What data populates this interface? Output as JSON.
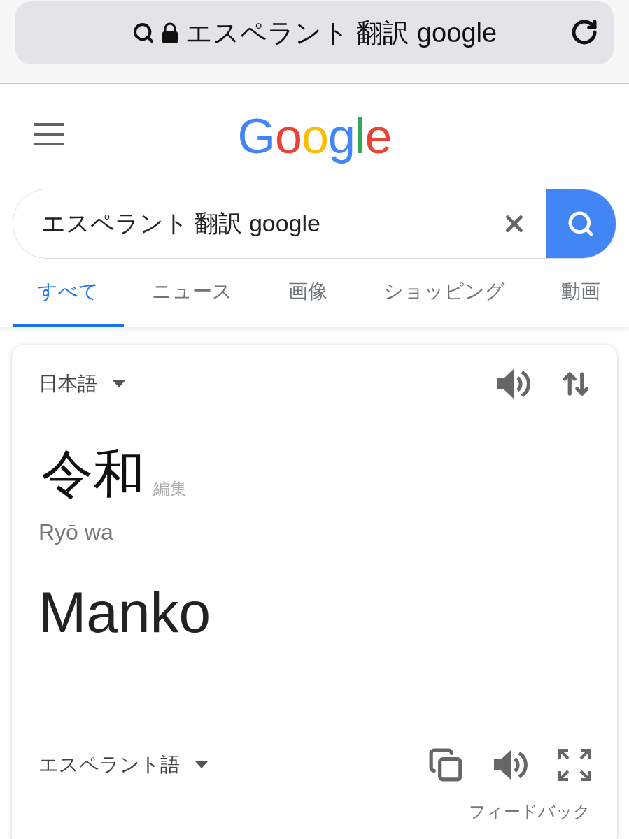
{
  "address_bar": {
    "text": "エスペラント 翻訳 google"
  },
  "logo": {
    "text": "Google"
  },
  "search": {
    "value": "エスペラント 翻訳 google"
  },
  "tabs": [
    {
      "label": "すべて",
      "selected": true
    },
    {
      "label": "ニュース",
      "selected": false
    },
    {
      "label": "画像",
      "selected": false
    },
    {
      "label": "ショッピング",
      "selected": false
    },
    {
      "label": "動画",
      "selected": false
    }
  ],
  "translation": {
    "source_language": "日本語",
    "source_text": "令和",
    "edit_label": "編集",
    "romanization": "Ryō wa",
    "result_text": "Manko",
    "target_language": "エスペラント語",
    "feedback": "フィードバック"
  }
}
